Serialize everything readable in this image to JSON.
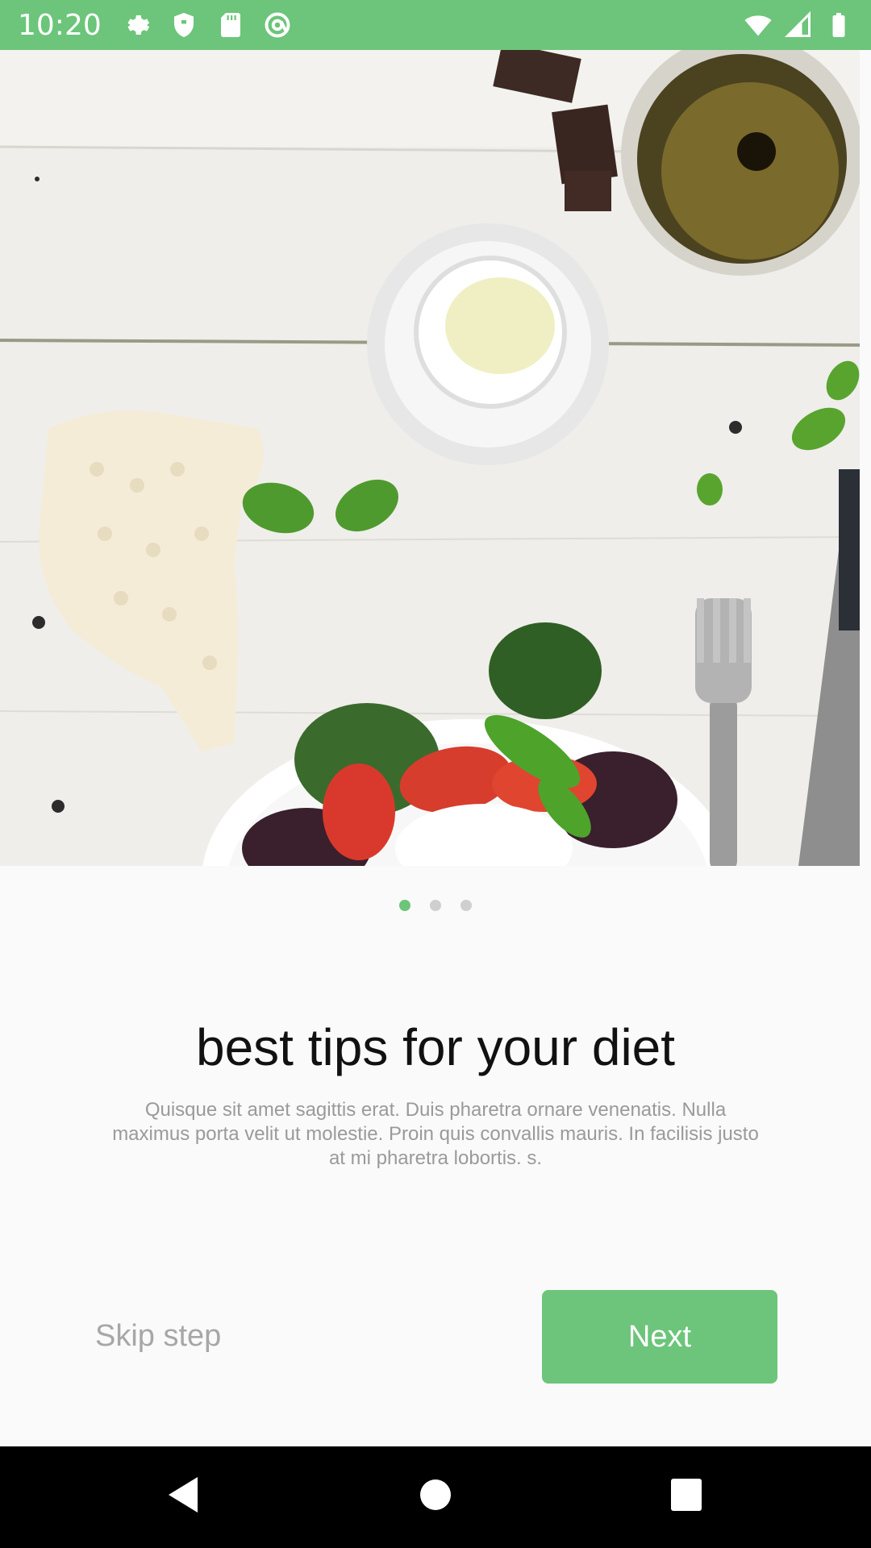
{
  "status_bar": {
    "time": "10:20",
    "left_icons": [
      "settings-icon",
      "shield-icon",
      "sd-card-icon",
      "at-sign-icon"
    ],
    "right_icons": [
      "wifi-icon",
      "signal-icon",
      "battery-icon"
    ],
    "color": "#6cc57a"
  },
  "hero": {
    "image_description_name": "food-photo"
  },
  "pager": {
    "total": 3,
    "active_index": 0
  },
  "content": {
    "title": "best tips for your diet",
    "description": "Quisque sit amet sagittis erat. Duis pharetra ornare venenatis. Nulla maximus porta velit ut molestie. Proin quis convallis mauris. In facilisis justo at mi pharetra lobortis. s."
  },
  "actions": {
    "skip_label": "Skip step",
    "next_label": "Next"
  },
  "colors": {
    "accent": "#6cc57a",
    "title_text": "#111111",
    "muted_text": "#9a9a9a"
  }
}
